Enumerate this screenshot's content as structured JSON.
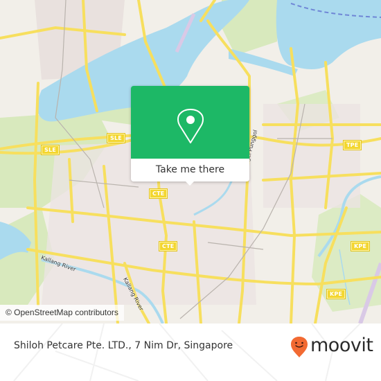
{
  "map": {
    "attribution": "© OpenStreetMap contributors",
    "road_labels": {
      "sle_left": "SLE",
      "sle_right": "SLE",
      "cte_top": "CTE",
      "cte_bottom": "CTE",
      "tpe": "TPE",
      "kpe_top": "KPE",
      "kpe_bottom": "KPE"
    },
    "place_labels": {
      "kallang_river_1": "Kallang River",
      "kallang_river_2": "Kallang River",
      "sungei_punggol": "Sungei Punggol"
    },
    "colors": {
      "land": "#f2efe9",
      "water": "#aadaee",
      "park": "#d4e7b5",
      "road": "#f7df5e"
    }
  },
  "popup": {
    "icon": "map-pin-icon",
    "button_label": "Take me there",
    "accent_color": "#1db866"
  },
  "footer": {
    "address": "Shiloh Petcare Pte. LTD., 7 Nim Dr, Singapore",
    "brand": "moovit",
    "brand_color": "#f26a32"
  }
}
